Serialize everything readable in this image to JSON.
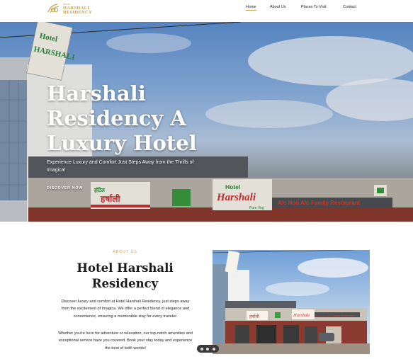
{
  "brand": {
    "small": "Hotel",
    "name": "HARSHALI",
    "name2": "RESIDENCY",
    "color": "#c9a24a"
  },
  "nav": {
    "items": [
      {
        "label": "Home",
        "active": true
      },
      {
        "label": "About Us",
        "active": false
      },
      {
        "label": "Places To Visit",
        "active": false
      },
      {
        "label": "Contact",
        "active": false
      }
    ]
  },
  "hero": {
    "title": "Harshali Residency A Luxury Hotel",
    "subtitle": "Experience Luxury and Comfort Just Steps Away from the Thrills of Imagica!",
    "cta": "DISCOVER NOW",
    "signage": {
      "vertical_sign": "Hotel HARSHALI",
      "marathi_sign": "हॉटेल हर्षाली",
      "main_sign_top": "Hotel",
      "main_sign": "Harshali",
      "veg_label": "Pure Veg",
      "restaurant": "A/c Non A/c Family Restaurant"
    }
  },
  "about": {
    "tag": "ABOUT US",
    "title": "Hotel Harshali Residency",
    "paragraph1": "Discover luxury and comfort at Hotel Harshali Residency, just steps away from the excitement of Imagica. We offer a perfect blend of elegance and convenience, ensuring a memorable stay for every traveler.",
    "paragraph2": "Whether you're here for adventure or relaxation, our top-notch amenities and exceptional service have you covered. Book your stay today and experience the best of both worlds!"
  },
  "icons": {
    "logo": "hotel-logo-icon",
    "chat": "chat-widget-icon"
  }
}
